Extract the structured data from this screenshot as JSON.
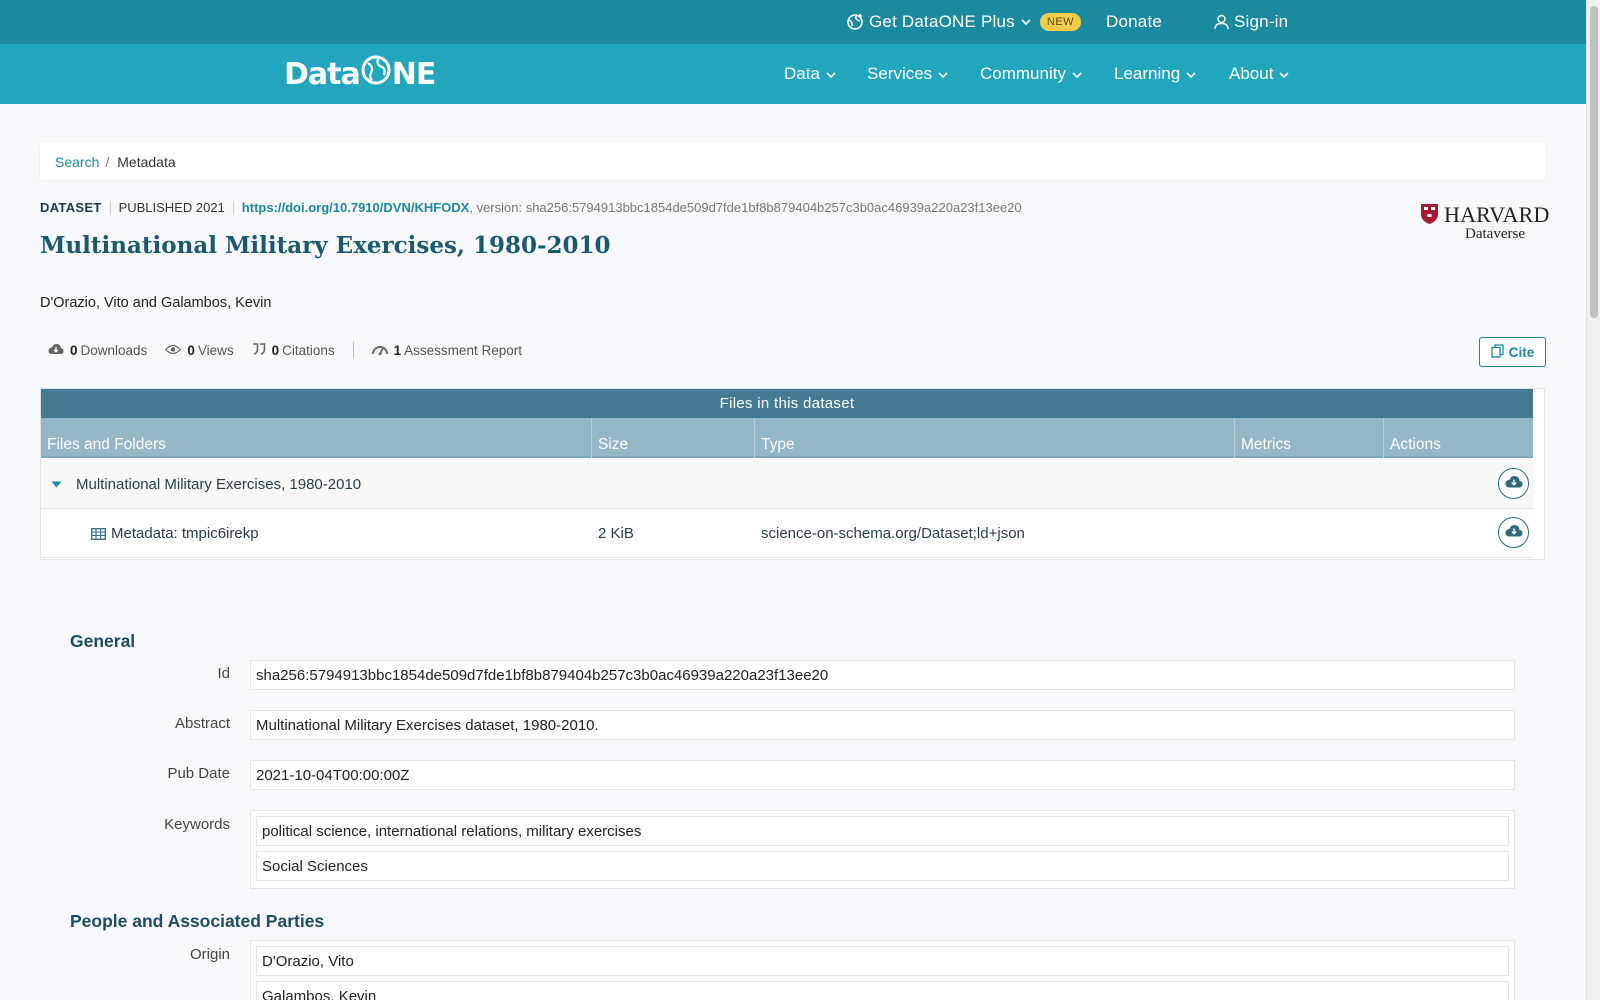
{
  "topbar": {
    "plus_label": "Get DataONE Plus",
    "plus_badge": "NEW",
    "donate_label": "Donate",
    "signin_label": "Sign-in"
  },
  "nav": {
    "logo_left": "Data",
    "logo_right": "NE",
    "items": [
      {
        "label": "Data"
      },
      {
        "label": "Services"
      },
      {
        "label": "Community"
      },
      {
        "label": "Learning"
      },
      {
        "label": "About"
      }
    ]
  },
  "breadcrumb": {
    "search": "Search",
    "separator": "/",
    "current": "Metadata"
  },
  "dataset": {
    "type_label": "DATASET",
    "published": "PUBLISHED 2021",
    "doi": "https://doi.org/10.7910/DVN/KHFODX",
    "version": ", version: sha256:5794913bbc1854de509d7fde1bf8b879404b257c3b0ac46939a220a23f13ee20",
    "title": "Multinational Military Exercises, 1980-2010",
    "authors": "D'Orazio, Vito and Galambos, Kevin",
    "repository": {
      "name": "HARVARD",
      "sub": "Dataverse"
    }
  },
  "stats": {
    "downloads": {
      "count": "0",
      "label": "Downloads"
    },
    "views": {
      "count": "0",
      "label": "Views"
    },
    "citations": {
      "count": "0",
      "label": "Citations"
    },
    "assessment": {
      "count": "1",
      "label": "Assessment Report"
    },
    "cite_label": "Cite"
  },
  "files": {
    "caption": "Files in this dataset",
    "columns": [
      "Files and Folders",
      "Size",
      "Type",
      "Metrics",
      "Actions"
    ],
    "folder": {
      "name": "Multinational Military Exercises, 1980-2010"
    },
    "file": {
      "name": "Metadata: tmpic6irekp",
      "size": "2 KiB",
      "type": "science-on-schema.org/Dataset;ld+json"
    }
  },
  "general": {
    "title": "General",
    "id_label": "Id",
    "id_value": "sha256:5794913bbc1854de509d7fde1bf8b879404b257c3b0ac46939a220a23f13ee20",
    "abstract_label": "Abstract",
    "abstract_value": "Multinational Military Exercises dataset, 1980-2010.",
    "pubdate_label": "Pub Date",
    "pubdate_value": "2021-10-04T00:00:00Z",
    "keywords_label": "Keywords",
    "keywords": [
      "political science, international relations, military exercises",
      "Social Sciences"
    ]
  },
  "people": {
    "title": "People and Associated Parties",
    "origin_label": "Origin",
    "origins": [
      "D'Orazio, Vito",
      "Galambos, Kevin"
    ]
  },
  "colors": {
    "topbar": "#1b8a9e",
    "navbar": "#21a6bd",
    "table_caption": "#447b93",
    "table_header": "#93b7c7",
    "accent": "#1b8a9e",
    "badge": "#f3cc4b"
  }
}
